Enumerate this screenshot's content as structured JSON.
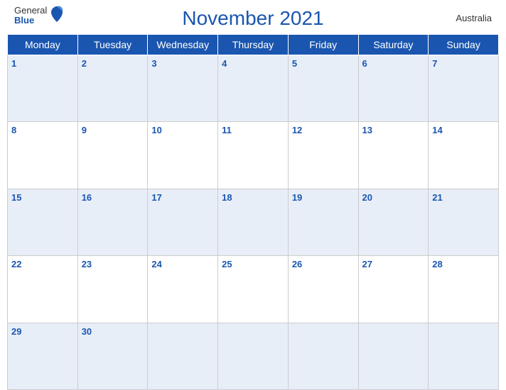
{
  "header": {
    "title": "November 2021",
    "country": "Australia",
    "logo_general": "General",
    "logo_blue": "Blue"
  },
  "days_of_week": [
    "Monday",
    "Tuesday",
    "Wednesday",
    "Thursday",
    "Friday",
    "Saturday",
    "Sunday"
  ],
  "weeks": [
    [
      {
        "date": "1",
        "empty": false
      },
      {
        "date": "2",
        "empty": false
      },
      {
        "date": "3",
        "empty": false
      },
      {
        "date": "4",
        "empty": false
      },
      {
        "date": "5",
        "empty": false
      },
      {
        "date": "6",
        "empty": false
      },
      {
        "date": "7",
        "empty": false
      }
    ],
    [
      {
        "date": "8",
        "empty": false
      },
      {
        "date": "9",
        "empty": false
      },
      {
        "date": "10",
        "empty": false
      },
      {
        "date": "11",
        "empty": false
      },
      {
        "date": "12",
        "empty": false
      },
      {
        "date": "13",
        "empty": false
      },
      {
        "date": "14",
        "empty": false
      }
    ],
    [
      {
        "date": "15",
        "empty": false
      },
      {
        "date": "16",
        "empty": false
      },
      {
        "date": "17",
        "empty": false
      },
      {
        "date": "18",
        "empty": false
      },
      {
        "date": "19",
        "empty": false
      },
      {
        "date": "20",
        "empty": false
      },
      {
        "date": "21",
        "empty": false
      }
    ],
    [
      {
        "date": "22",
        "empty": false
      },
      {
        "date": "23",
        "empty": false
      },
      {
        "date": "24",
        "empty": false
      },
      {
        "date": "25",
        "empty": false
      },
      {
        "date": "26",
        "empty": false
      },
      {
        "date": "27",
        "empty": false
      },
      {
        "date": "28",
        "empty": false
      }
    ],
    [
      {
        "date": "29",
        "empty": false
      },
      {
        "date": "30",
        "empty": false
      },
      {
        "date": "",
        "empty": true
      },
      {
        "date": "",
        "empty": true
      },
      {
        "date": "",
        "empty": true
      },
      {
        "date": "",
        "empty": true
      },
      {
        "date": "",
        "empty": true
      }
    ]
  ]
}
